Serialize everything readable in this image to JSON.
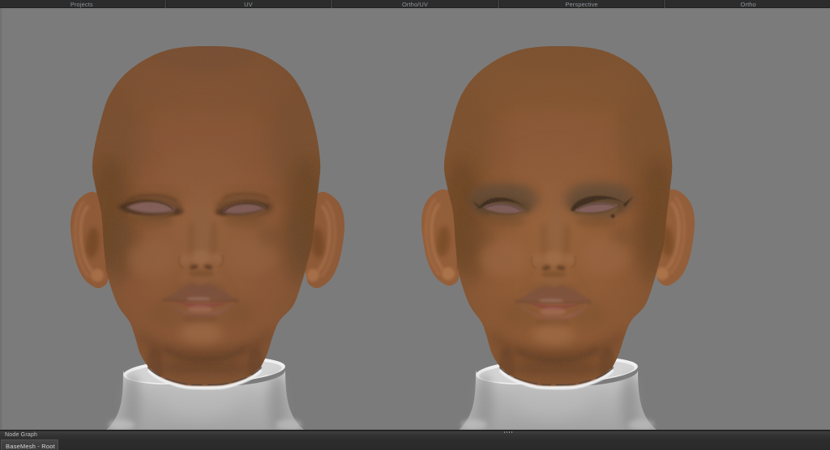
{
  "app": {
    "viewport_background": "#7b7b7b",
    "chrome_background": "#2c2c2c",
    "panel_background": "#2e2e2e"
  },
  "tabbar": {
    "tabs": [
      {
        "label": "Projects"
      },
      {
        "label": "UV"
      },
      {
        "label": "Ortho/UV"
      },
      {
        "label": "Perspective"
      },
      {
        "label": "Ortho"
      }
    ]
  },
  "viewport": {
    "models": [
      {
        "id": "head-left",
        "description": "bald textured head bust, front view"
      },
      {
        "id": "head-right",
        "description": "bald textured head bust with eyeliner and mole, front view"
      }
    ],
    "palette": {
      "skin_base": "#8a5637",
      "skin_highlight": "#a06943",
      "skin_shadow": "#5e3a20",
      "eyeball": "#997476",
      "lips": "#8e584a",
      "bust_white": "#d9d9d9"
    }
  },
  "nodegraph": {
    "title": "Node Graph",
    "nodes": [
      {
        "label": "BaseMesh - Root"
      }
    ]
  }
}
